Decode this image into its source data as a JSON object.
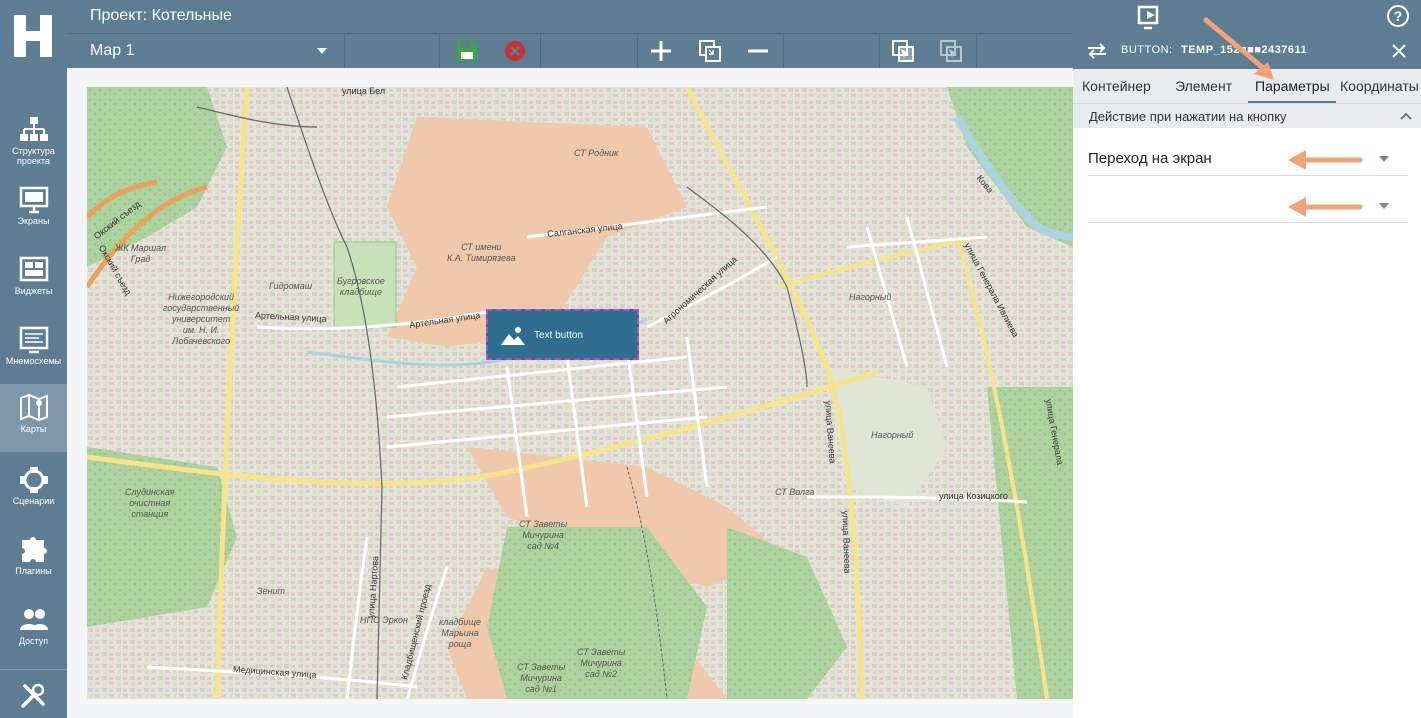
{
  "header": {
    "project_title": "Проект: Котельные"
  },
  "sidebar": {
    "items": [
      {
        "label": "Структура проекта",
        "icon": "structure-icon"
      },
      {
        "label": "Экраны",
        "icon": "monitor-icon"
      },
      {
        "label": "Виджеты",
        "icon": "widgets-icon"
      },
      {
        "label": "Мнемосхемы",
        "icon": "mnemoscheme-icon"
      },
      {
        "label": "Карты",
        "icon": "map-icon",
        "active": true
      },
      {
        "label": "Сценарии",
        "icon": "scenario-icon"
      },
      {
        "label": "Плагины",
        "icon": "puzzle-icon"
      },
      {
        "label": "Доступ",
        "icon": "users-icon"
      }
    ]
  },
  "toolbar": {
    "map_select_value": "Map 1"
  },
  "map": {
    "widget_label": "Text button",
    "labels": {
      "rodnik": "СТ Родник",
      "timiryazev": "СТ имени\nК.А. Тимирязева",
      "marshal": "ЖК Маршал\nГрад",
      "university": "Нижегородский\nгосударственный\nуниверситет\nим. Н. И.\nЛобачевского",
      "gidromash": "Гидромаш",
      "bugrovskoe": "Бугровское\nкладбище",
      "nagorny1": "Нагорный",
      "nagorny2": "Нагорный",
      "volga": "СТ Волга",
      "zavety4": "СТ Заветы\nМичурина\nсад №4",
      "sludinskaya": "Слудинская\nочистная\nстанция",
      "zenit": "Зенит",
      "npo": "НПО Эркон",
      "marina": "кладбище\nМарьина\nроща",
      "zavety2": "СТ Заветы\nМичурина\nсад №2",
      "zavety1": "СТ Заветы\nМичурина\nсад №1"
    },
    "streets": {
      "belinskogo": "улица Бел",
      "salganskaya": "Салганская улица",
      "artelnaya1": "Артельная улица",
      "artelnaya2": "Артельная улица",
      "agronomicheskaya": "Агрономическая улица",
      "vaneeva1": "улица Ванеева",
      "vaneeva2": "улица Ванеева",
      "kozitskogo": "улица Козицкого",
      "ivlieva": "улица Генерала Ивлиева",
      "ivlieva2": "улица Генерала",
      "nartova": "улица Нартова",
      "kladbishensky": "Кладбищенский проезд",
      "medicinskaya": "Медицинская улица",
      "oksky": "Окский съезд",
      "oksky2": "Окский съезд",
      "kova": "Кова"
    }
  },
  "panel": {
    "title_type": "BUTTON:",
    "title_id": "TEMP_152■■■2437611",
    "tabs": [
      {
        "label": "Контейнер"
      },
      {
        "label": "Элемент"
      },
      {
        "label": "Параметры",
        "active": true
      },
      {
        "label": "Координаты"
      }
    ],
    "section_title": "Действие при нажатии на кнопку",
    "fields": [
      {
        "value": "Переход на экран"
      },
      {
        "value": ""
      }
    ]
  },
  "colors": {
    "chrome": "#5e7d93",
    "annotation_arrow": "#f0a37a",
    "widget_fill": "#2f6e8e",
    "widget_border": "#b04fc3"
  }
}
